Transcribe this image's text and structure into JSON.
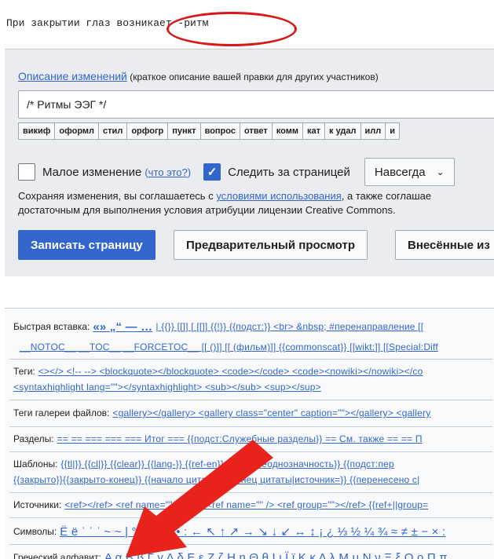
{
  "editor": {
    "code_line": "При закрытии глаз возникает -ритм"
  },
  "summary": {
    "label_link": "Описание изменений",
    "label_hint": " (краткое описание вашей правки для других участников)",
    "value": "/* Ритмы ЭЭГ */",
    "shortcuts": [
      "викиф",
      "оформл",
      "стил",
      "орфогр",
      "пункт",
      "вопрос",
      "ответ",
      "комм",
      "кат",
      "к удал",
      "илл",
      "и"
    ]
  },
  "options": {
    "minor_label": "Малое изменение",
    "minor_help_open": "(",
    "minor_help": "что это?",
    "minor_help_close": ")",
    "watch_label": "Следить за страницей",
    "watch_checkmark": "✓",
    "watch_period": "Навсегда",
    "dropdown_chevron": "⌄"
  },
  "terms": {
    "line1_pre": "Сохраняя изменения, вы соглашаетесь с ",
    "line1_link": "условиями использования",
    "line1_post": ", а также соглашае",
    "line2": "достаточным для выполнения условия атрибуции лицензии Creative Commons."
  },
  "buttons": {
    "save": "Записать страницу",
    "preview": "Предварительный просмотр",
    "changes": "Внесённые из"
  },
  "charinsert": {
    "quick_label": "Быстрая вставка:",
    "quick_items": "«» „“ — …",
    "quick_rest": "| {{}} [[]] [ [[]] {{!}} {{подст:}} <br> &nbsp; #перенаправление [[",
    "magic_items": "__NOTOC__  __TOC__  __FORCETOC__  [[ ()]] [[ (фильм)]] {{commonscat}} [[wikt:]] [[Special:Diff",
    "tags_label": "Теги:",
    "tags_items": "<></>  <!-- -->  <blockquote></blockquote>  <code></code>  <code><nowiki></nowiki></co",
    "tags_items2": "<syntaxhighlight lang=\"\"></syntaxhighlight>  <sub></sub>  <sup></sup>",
    "gallery_label": "Теги галереи файлов:",
    "gallery_items": "<gallery></gallery>  <gallery class=\"center\" caption=\"\"></gallery>  <gallery",
    "sections_label": "Разделы:",
    "sections_items": "== ==  === ===  === Итог ===  {{подст:Служебные разделы}}  == См. также ==  == П",
    "templates_label": "Шаблоны:",
    "templates_items": "{{tl|}}  {{cl|}}  {{clear}}  {{lang-}}  {{ref-en}}  {{sl}}  {{неоднозначность}}  {{подст:пер",
    "templates_items2": "{{закрыто}}{{закрыто-конец}}  {{начало цитаты}}{{конец цитаты|источник=}}  {{перенесено с|",
    "sources_label": "Источники:",
    "sources_items": "<ref></ref>  <ref name=\"\"></ref>  <ref name=\"\" />  <ref group=\"\"></ref>  {{ref+||group=",
    "symbols_label": "Символы:",
    "symbols_items": "Ё ё ˈ ˈ ˈ ~ ~ | ° § ¶ № • : ← ↖ ↑ ↗ → ↘ ↓ ↙ ↔ ↕ ¡ ¿ ⅓ ½ ¼ ¾ ≈ ≠ ± − × :",
    "greek_label": "Греческий алфавит:",
    "greek_items": "Α α Β β Γ γ Δ δ Ε ε Ζ ζ Η η Θ θ Ι ι Ϊ ϊ Κ κ Λ λ Μ μ Ν ν Ξ ξ Ο ο Π π"
  },
  "annotation": {
    "ellipse_color": "#d7191c",
    "arrow_color": "#e8231c"
  }
}
